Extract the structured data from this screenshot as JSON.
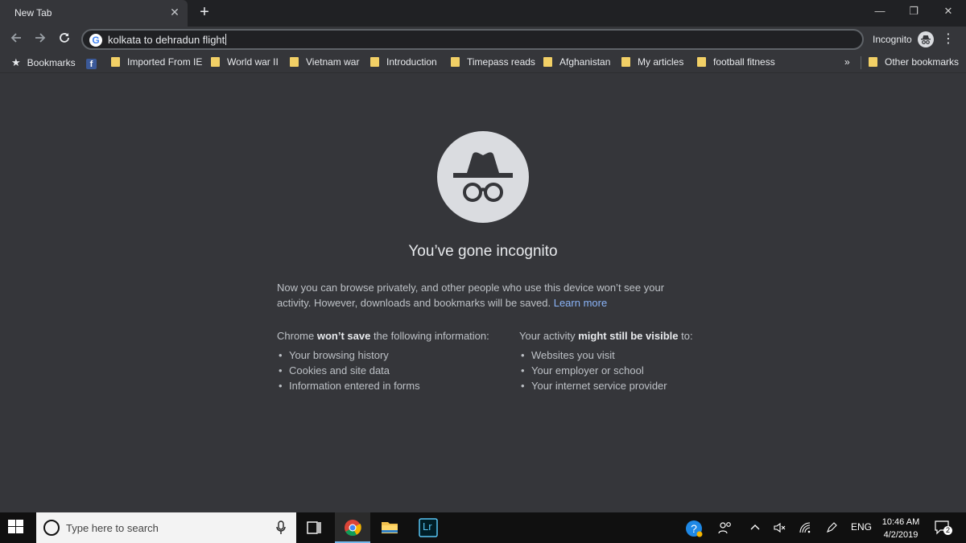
{
  "browser": {
    "tab_title": "New Tab",
    "tab_close": "✕",
    "new_tab": "+",
    "window_minimize": "—",
    "window_restore": "❐",
    "window_close": "✕",
    "address": "kolkata to dehradun flight",
    "profile_label": "Incognito"
  },
  "bookmarks": {
    "root_label": "Bookmarks",
    "items": [
      "Imported From IE",
      "World war II",
      "Vietnam war",
      "Introduction",
      "Timepass reads",
      "Afghanistan",
      "My articles",
      "football fitness"
    ],
    "overflow": "»",
    "other": "Other bookmarks"
  },
  "incognito": {
    "headline": "You’ve gone incognito",
    "description": "Now you can browse privately, and other people who use this device won’t see your activity. However, downloads and bookmarks will be saved.",
    "learn_more": "Learn more",
    "left_heading_pre": "Chrome ",
    "left_heading_bold": "won’t save",
    "left_heading_post": " the following information:",
    "left_items": [
      "Your browsing history",
      "Cookies and site data",
      "Information entered in forms"
    ],
    "right_heading_pre": "Your activity ",
    "right_heading_bold": "might still be visible",
    "right_heading_post": " to:",
    "right_items": [
      "Websites you visit",
      "Your employer or school",
      "Your internet service provider"
    ]
  },
  "taskbar": {
    "search_placeholder": "Type here to search",
    "lightroom_label": "Lr",
    "language": "ENG",
    "time": "10:46 AM",
    "date": "4/2/2019",
    "notification_count": "2"
  },
  "colors": {
    "background": "#35363a",
    "titlebar": "#202124",
    "link": "#8ab4f8",
    "bookmark_folder": "#f2d066"
  }
}
